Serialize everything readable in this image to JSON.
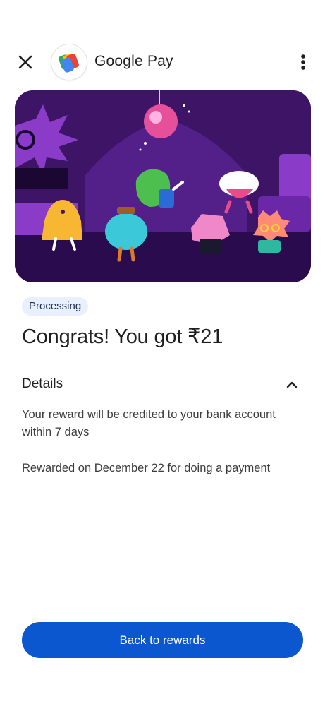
{
  "header": {
    "app_title": "Google Pay",
    "close_icon": "close-icon",
    "menu_icon": "more-vert-icon"
  },
  "reward": {
    "status": "Processing",
    "headline": "Congrats! You got ₹21"
  },
  "details": {
    "title": "Details",
    "expanded": true,
    "line1": "Your reward will be credited to your bank account within 7 days",
    "line2": "Rewarded on December 22 for doing a payment"
  },
  "actions": {
    "back_label": "Back to rewards"
  },
  "colors": {
    "primary_button": "#0b57d0",
    "badge_bg": "#e8f0fe",
    "hero_bg": "#3d1466"
  }
}
